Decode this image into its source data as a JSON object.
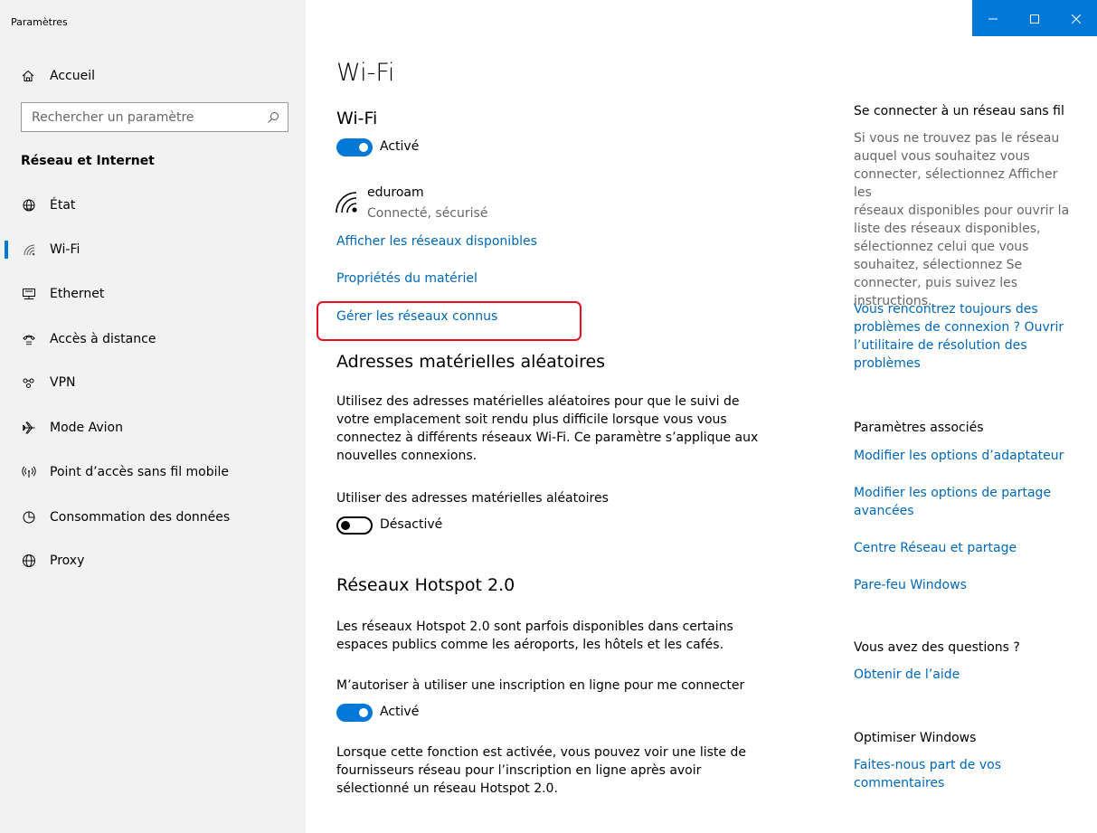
{
  "window": {
    "title": "Paramètres"
  },
  "sidebar": {
    "home_label": "Accueil",
    "search_placeholder": "Rechercher un paramètre",
    "section_title": "Réseau et Internet",
    "items": [
      {
        "label": "État",
        "icon": "globe-status-icon"
      },
      {
        "label": "Wi-Fi",
        "icon": "wifi-icon",
        "active": true
      },
      {
        "label": "Ethernet",
        "icon": "ethernet-icon"
      },
      {
        "label": "Accès à distance",
        "icon": "dialup-icon"
      },
      {
        "label": "VPN",
        "icon": "vpn-icon"
      },
      {
        "label": "Mode Avion",
        "icon": "airplane-icon"
      },
      {
        "label": "Point d’accès sans fil mobile",
        "icon": "hotspot-icon"
      },
      {
        "label": "Consommation des données",
        "icon": "data-usage-icon"
      },
      {
        "label": "Proxy",
        "icon": "proxy-globe-icon"
      }
    ]
  },
  "main": {
    "title": "Wi-Fi",
    "wifi_heading": "Wi-Fi",
    "wifi_toggle_label": "Activé",
    "network": {
      "name": "eduroam",
      "status": "Connecté, sécurisé"
    },
    "link_show_networks": "Afficher les réseaux disponibles",
    "link_hardware_props": "Propriétés du matériel",
    "link_manage_known": "Gérer les réseaux connus",
    "random_heading": "Adresses matérielles aléatoires",
    "random_desc_lines": [
      "Utilisez des adresses matérielles aléatoires pour que le suivi de",
      "votre emplacement soit rendu plus difficile lorsque vous vous",
      "connectez à différents réseaux Wi-Fi. Ce paramètre s’applique aux",
      "nouvelles connexions."
    ],
    "random_setting_label": "Utiliser des adresses matérielles aléatoires",
    "random_toggle_label": "Désactivé",
    "hotspot_heading": "Réseaux Hotspot 2.0",
    "hotspot_desc_lines": [
      "Les réseaux Hotspot 2.0 sont parfois disponibles dans certains",
      "espaces publics comme les aéroports, les hôtels et les cafés."
    ],
    "hotspot_setting_label": "M’autoriser à utiliser une inscription en ligne pour me connecter",
    "hotspot_toggle_label": "Activé",
    "hotspot_note_lines": [
      "Lorsque cette fonction est activée, vous pouvez voir une liste de",
      "fournisseurs réseau pour l’inscription en ligne après avoir",
      "sélectionné un réseau Hotspot 2.0."
    ]
  },
  "right_panel": {
    "connect_heading": "Se connecter à un réseau sans fil",
    "connect_desc_lines": [
      "Si vous ne trouvez pas le réseau",
      "auquel vous souhaitez vous",
      "connecter, sélectionnez Afficher les",
      "réseaux disponibles pour ouvrir la",
      "liste des réseaux disponibles,",
      "sélectionnez celui que vous",
      "souhaitez, sélectionnez Se",
      "connecter, puis suivez les",
      "instructions."
    ],
    "troubleshoot_link_lines": [
      "Vous rencontrez toujours des",
      "problèmes de connexion ? Ouvrir",
      "l’utilitaire de résolution des",
      "problèmes"
    ],
    "related_heading": "Paramètres associés",
    "link_adapter": "Modifier les options d’adaptateur",
    "link_sharing_lines": [
      "Modifier les options de partage",
      "avancées"
    ],
    "link_network_center": "Centre Réseau et partage",
    "link_firewall": "Pare-feu Windows",
    "questions_heading": "Vous avez des questions ?",
    "link_help": "Obtenir de l’aide",
    "optimize_heading": "Optimiser Windows",
    "feedback_link_lines": [
      "Faites-nous part de vos",
      "commentaires"
    ]
  },
  "colors": {
    "accent": "#0078d7",
    "link": "#0067b8",
    "sidebar_bg": "#f2f2f2",
    "highlight": "#e81123"
  }
}
